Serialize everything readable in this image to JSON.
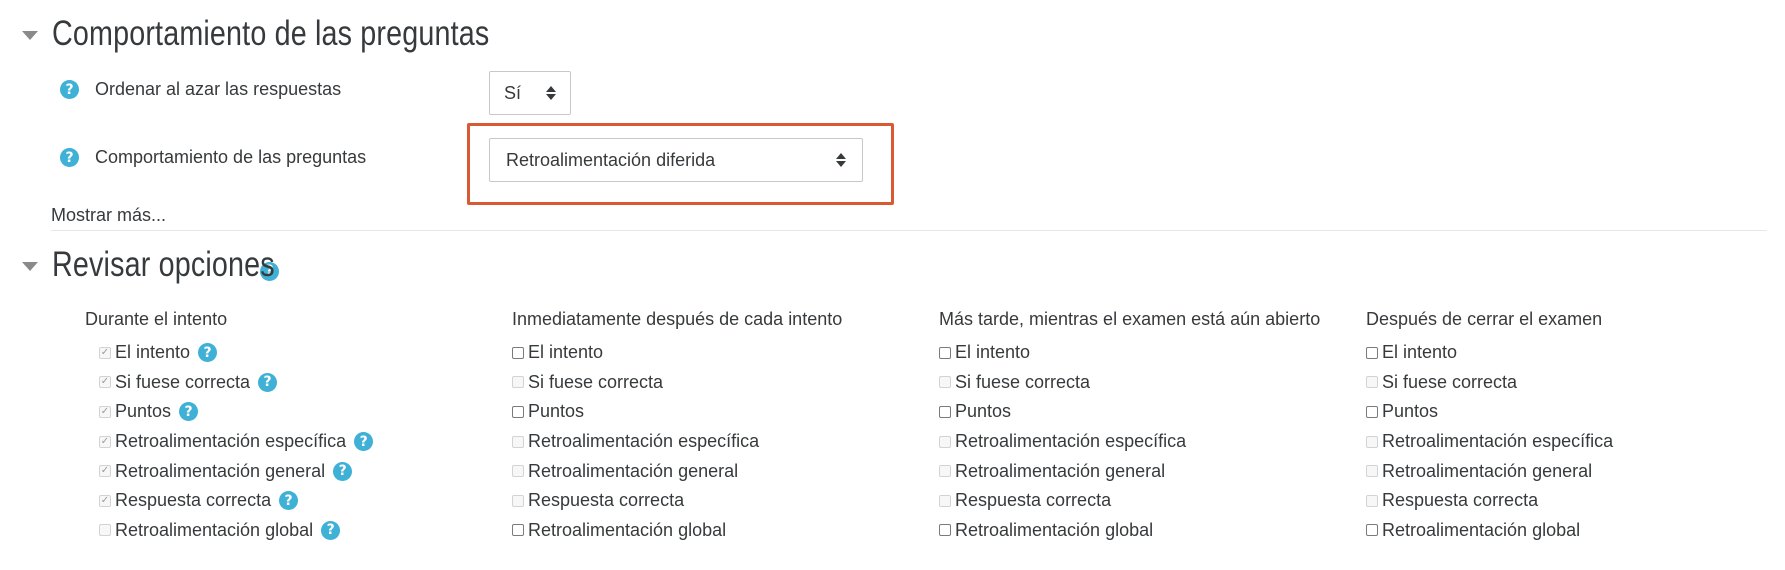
{
  "sections": {
    "behaviour": {
      "title": "Comportamiento de las preguntas"
    },
    "review": {
      "title": "Revisar opciones"
    }
  },
  "behaviour": {
    "shuffle": {
      "label": "Ordenar al azar las respuestas",
      "value": "Sí"
    },
    "mode": {
      "label": "Comportamiento de las preguntas",
      "value": "Retroalimentación diferida"
    },
    "show_more": "Mostrar más..."
  },
  "review": {
    "columns": [
      {
        "heading": "Durante el intento",
        "options": [
          {
            "label": "El intento",
            "checked": true,
            "disabled": true,
            "help": true
          },
          {
            "label": "Si fuese correcta",
            "checked": true,
            "disabled": true,
            "help": true
          },
          {
            "label": "Puntos",
            "checked": true,
            "disabled": true,
            "help": true
          },
          {
            "label": "Retroalimentación específica",
            "checked": true,
            "disabled": true,
            "help": true
          },
          {
            "label": "Retroalimentación general",
            "checked": true,
            "disabled": true,
            "help": true
          },
          {
            "label": "Respuesta correcta",
            "checked": true,
            "disabled": true,
            "help": true
          },
          {
            "label": "Retroalimentación global",
            "checked": false,
            "disabled": true,
            "help": true
          }
        ]
      },
      {
        "heading": "Inmediatamente después de cada intento",
        "options": [
          {
            "label": "El intento",
            "checked": false,
            "disabled": false
          },
          {
            "label": "Si fuese correcta",
            "checked": false,
            "disabled": true
          },
          {
            "label": "Puntos",
            "checked": false,
            "disabled": false
          },
          {
            "label": "Retroalimentación específica",
            "checked": false,
            "disabled": true
          },
          {
            "label": "Retroalimentación general",
            "checked": false,
            "disabled": true
          },
          {
            "label": "Respuesta correcta",
            "checked": false,
            "disabled": true
          },
          {
            "label": "Retroalimentación global",
            "checked": false,
            "disabled": false
          }
        ]
      },
      {
        "heading": "Más tarde, mientras el examen está aún abierto",
        "options": [
          {
            "label": "El intento",
            "checked": false,
            "disabled": false
          },
          {
            "label": "Si fuese correcta",
            "checked": false,
            "disabled": true
          },
          {
            "label": "Puntos",
            "checked": false,
            "disabled": false
          },
          {
            "label": "Retroalimentación específica",
            "checked": false,
            "disabled": true
          },
          {
            "label": "Retroalimentación general",
            "checked": false,
            "disabled": true
          },
          {
            "label": "Respuesta correcta",
            "checked": false,
            "disabled": true
          },
          {
            "label": "Retroalimentación global",
            "checked": false,
            "disabled": false
          }
        ]
      },
      {
        "heading": "Después de cerrar el examen",
        "options": [
          {
            "label": "El intento",
            "checked": false,
            "disabled": false
          },
          {
            "label": "Si fuese correcta",
            "checked": false,
            "disabled": true
          },
          {
            "label": "Puntos",
            "checked": false,
            "disabled": false
          },
          {
            "label": "Retroalimentación específica",
            "checked": false,
            "disabled": true
          },
          {
            "label": "Retroalimentación general",
            "checked": false,
            "disabled": true
          },
          {
            "label": "Respuesta correcta",
            "checked": false,
            "disabled": true
          },
          {
            "label": "Retroalimentación global",
            "checked": false,
            "disabled": false
          }
        ]
      }
    ]
  },
  "icons": {
    "help": "question-circle-icon",
    "collapse": "caret-down-icon",
    "select": "up-down-arrows-icon"
  },
  "colors": {
    "accent": "#3fb0d6",
    "highlight": "#d85a32",
    "text": "#373a3c"
  }
}
